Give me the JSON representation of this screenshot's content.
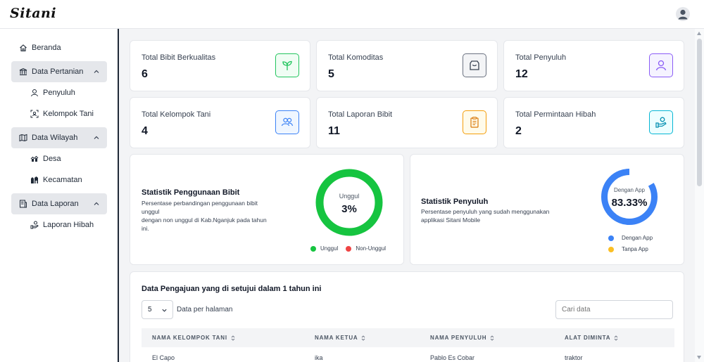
{
  "app": {
    "logo": "Sitani"
  },
  "sidebar": {
    "items": [
      {
        "label": "Beranda",
        "icon": "home-icon",
        "type": "item"
      },
      {
        "label": "Data Pertanian",
        "icon": "building-icon",
        "type": "group",
        "expanded": true
      },
      {
        "label": "Penyuluh",
        "icon": "user-icon",
        "type": "sub"
      },
      {
        "label": "Kelompok Tani",
        "icon": "group-scan-icon",
        "type": "sub"
      },
      {
        "label": "Data Wilayah",
        "icon": "map-icon",
        "type": "group",
        "expanded": true
      },
      {
        "label": "Desa",
        "icon": "village-icon",
        "type": "sub"
      },
      {
        "label": "Kecamatan",
        "icon": "buildings-icon",
        "type": "sub"
      },
      {
        "label": "Data Laporan",
        "icon": "report-icon",
        "type": "group",
        "expanded": true
      },
      {
        "label": "Laporan Hibah",
        "icon": "hand-grant-icon",
        "type": "sub"
      }
    ]
  },
  "stats": [
    {
      "label": "Total Bibit Berkualitas",
      "value": "6",
      "icon": "sprout-icon",
      "color": "#22c55e"
    },
    {
      "label": "Total Komoditas",
      "value": "5",
      "icon": "box-icon",
      "color": "#6b7280"
    },
    {
      "label": "Total Penyuluh",
      "value": "12",
      "icon": "person-icon",
      "color": "#8b5cf6"
    },
    {
      "label": "Total Kelompok Tani",
      "value": "4",
      "icon": "users-icon",
      "color": "#3b82f6"
    },
    {
      "label": "Total Laporan Bibit",
      "value": "11",
      "icon": "clipboard-icon",
      "color": "#f59e0b"
    },
    {
      "label": "Total Permintaan Hibah",
      "value": "2",
      "icon": "grant-icon",
      "color": "#06b6d4"
    }
  ],
  "bibit_chart": {
    "title": "Statistik Penggunaan Bibit",
    "desc1": "Persentase perbandingan penggunaan bibit",
    "desc2": "unggul",
    "desc3": "dengan non unggul di Kab.Nganjuk pada tahun",
    "desc4": "ini.",
    "center_label": "Unggul",
    "center_value": "3%",
    "legend": [
      "Unggul",
      "Non-Unggul"
    ],
    "colors": [
      "#16c440",
      "#ef4444"
    ]
  },
  "penyuluh_chart": {
    "title": "Statistik Penyuluh",
    "desc1": "Persentase penyuluh yang sudah menggunakan",
    "desc2": "applikasi Sitani Mobile",
    "center_label": "Dengan App",
    "center_value": "83.33%",
    "legend": [
      "Dengan App",
      "Tanpa App"
    ],
    "colors": [
      "#3b82f6",
      "#fbbf24"
    ]
  },
  "chart_data": [
    {
      "type": "pie",
      "categories": [
        "Unggul",
        "Non-Unggul"
      ],
      "values": [
        100,
        0
      ]
    },
    {
      "type": "pie",
      "categories": [
        "Dengan App",
        "Tanpa App"
      ],
      "values": [
        83.33,
        16.67
      ]
    }
  ],
  "table": {
    "title": "Data Pengajuan yang di setujui dalam 1 tahun ini",
    "per_page_value": "5",
    "per_page_label": "Data per halaman",
    "search_placeholder": "Cari data",
    "columns": [
      "NAMA KELOMPOK TANI",
      "NAMA KETUA",
      "NAMA PENYULUH",
      "ALAT DIMINTA"
    ],
    "rows": [
      [
        "El Capo",
        "ika",
        "Pablo Es Cobar",
        "traktor"
      ]
    ]
  }
}
